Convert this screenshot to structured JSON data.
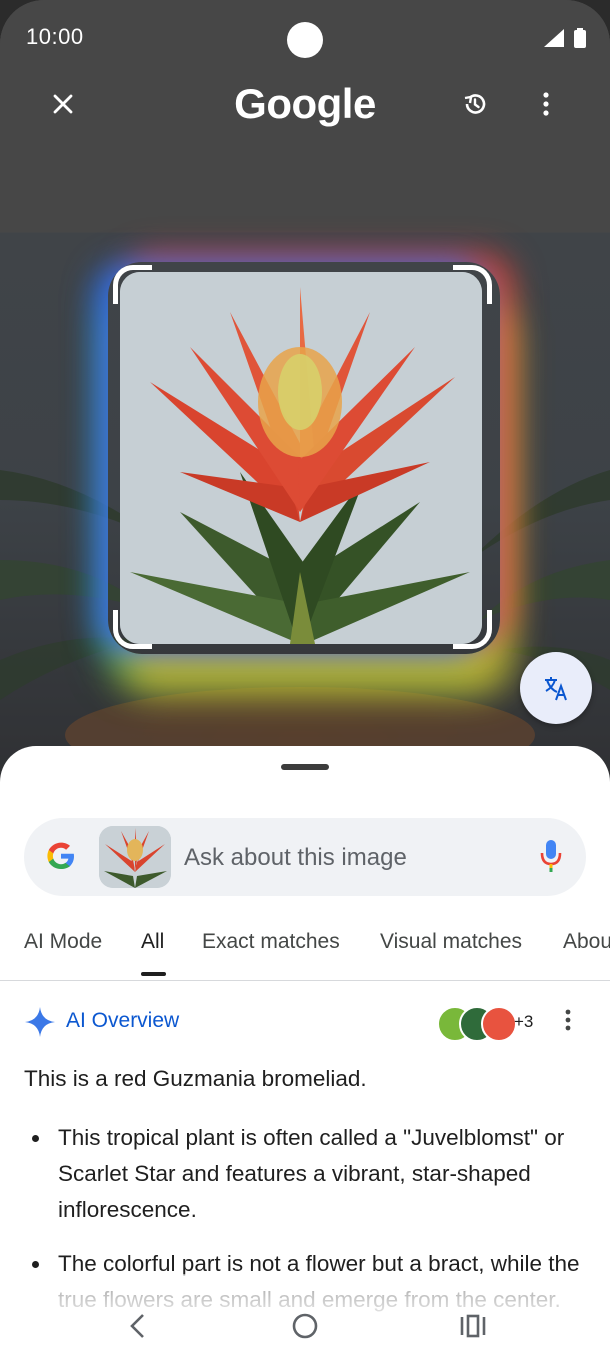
{
  "status_bar": {
    "time": "10:00"
  },
  "header": {
    "logo_text": "Google",
    "close_icon": "close-icon",
    "history_icon": "history-icon",
    "more_icon": "more-vert-icon"
  },
  "lens": {
    "translate_icon": "translate-icon",
    "accent_colors": [
      "#4285f4",
      "#ea4335",
      "#fbbc05",
      "#34a853"
    ]
  },
  "search": {
    "placeholder": "Ask about this image",
    "mic_icon": "mic-icon"
  },
  "tabs": [
    {
      "label": "AI Mode",
      "active": false
    },
    {
      "label": "All",
      "active": true
    },
    {
      "label": "Exact matches",
      "active": false
    },
    {
      "label": "Visual matches",
      "active": false
    },
    {
      "label": "About",
      "active": false
    }
  ],
  "ai_overview": {
    "title": "AI Overview",
    "source_count": "+3",
    "summary": "This is a red Guzmania bromeliad.",
    "bullets": [
      "This tropical plant is often called a \"Juvelblomst\" or Scarlet Star and features a vibrant, star-shaped inflorescence.",
      "The colorful part is not a flower but a bract, while the true flowers are small and emerge from the center."
    ]
  },
  "nav_bar": {
    "back_icon": "back-icon",
    "home_icon": "home-icon",
    "recents_icon": "recents-icon"
  }
}
